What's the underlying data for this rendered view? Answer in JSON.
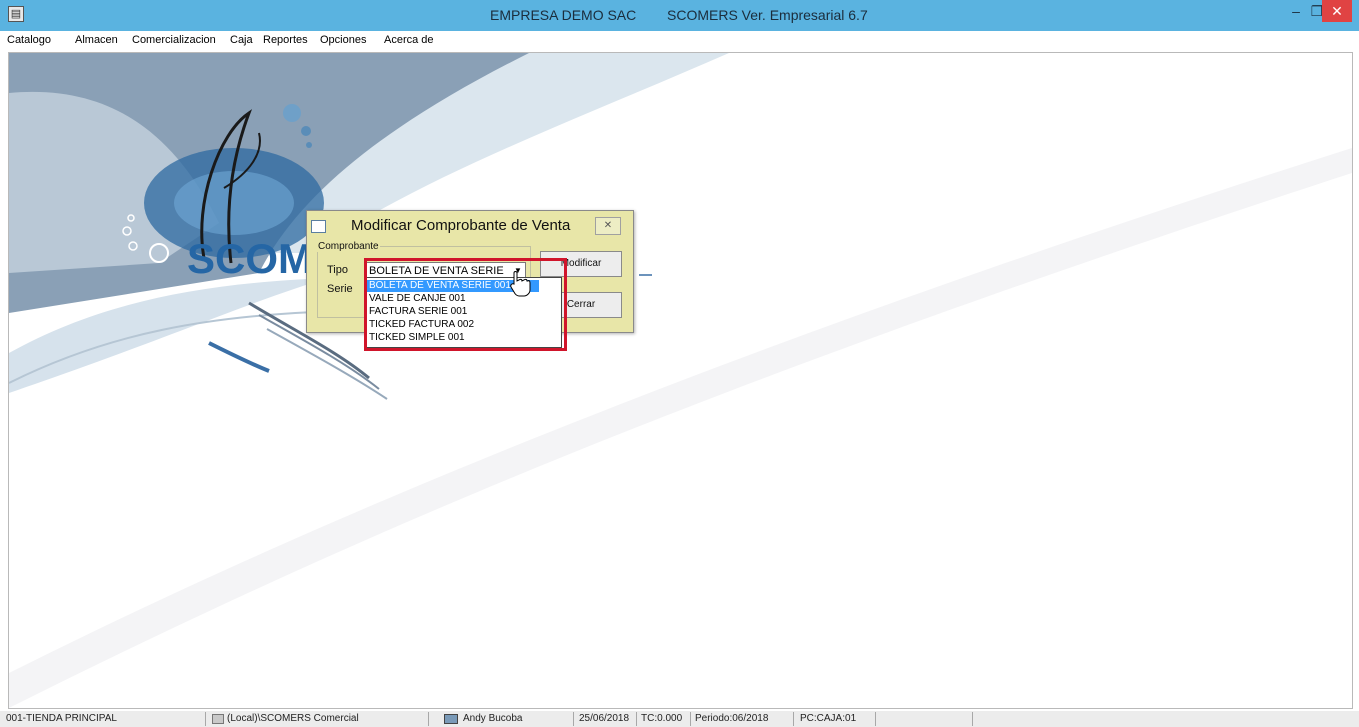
{
  "window": {
    "icon": "app-window-icon",
    "title_company": "EMPRESA DEMO SAC",
    "title_app": "SCOMERS Ver. Empresarial  6.7",
    "controls": {
      "minimize": "–",
      "maximize": "❐",
      "close": "✕"
    },
    "close_color": "#e04343"
  },
  "menu": {
    "items": [
      "Catalogo",
      "Almacen",
      "Comercializacion",
      "Caja",
      "Reportes",
      "Opciones",
      "Acerca de"
    ]
  },
  "background": {
    "logo_text": "SCOM"
  },
  "dialog": {
    "title": "Modificar Comprobante de Venta",
    "group_label": "Comprobante",
    "tipo_label": "Tipo",
    "serie_label": "Serie",
    "tipo_value": "BOLETA DE VENTA SERIE",
    "modify_button": "Modificar",
    "close_button": "Cerrar",
    "close_icon": "✕"
  },
  "dropdown": {
    "options": [
      "BOLETA DE VENTA SERIE 001",
      "VALE DE CANJE 001",
      "FACTURA SERIE 001",
      "TICKED FACTURA 002",
      "TICKED SIMPLE 001"
    ],
    "selected_index": 0,
    "highlight_color": "#d0152b",
    "selection_color": "#3399ff"
  },
  "status": {
    "store": "001-TIENDA PRINCIPAL",
    "database": "(Local)\\SCOMERS Comercial",
    "user": "Andy Bucoba",
    "date": "25/06/2018",
    "exchange": "TC:0.000",
    "period": "Periodo:06/2018",
    "pc": "PC:CAJA:01"
  }
}
